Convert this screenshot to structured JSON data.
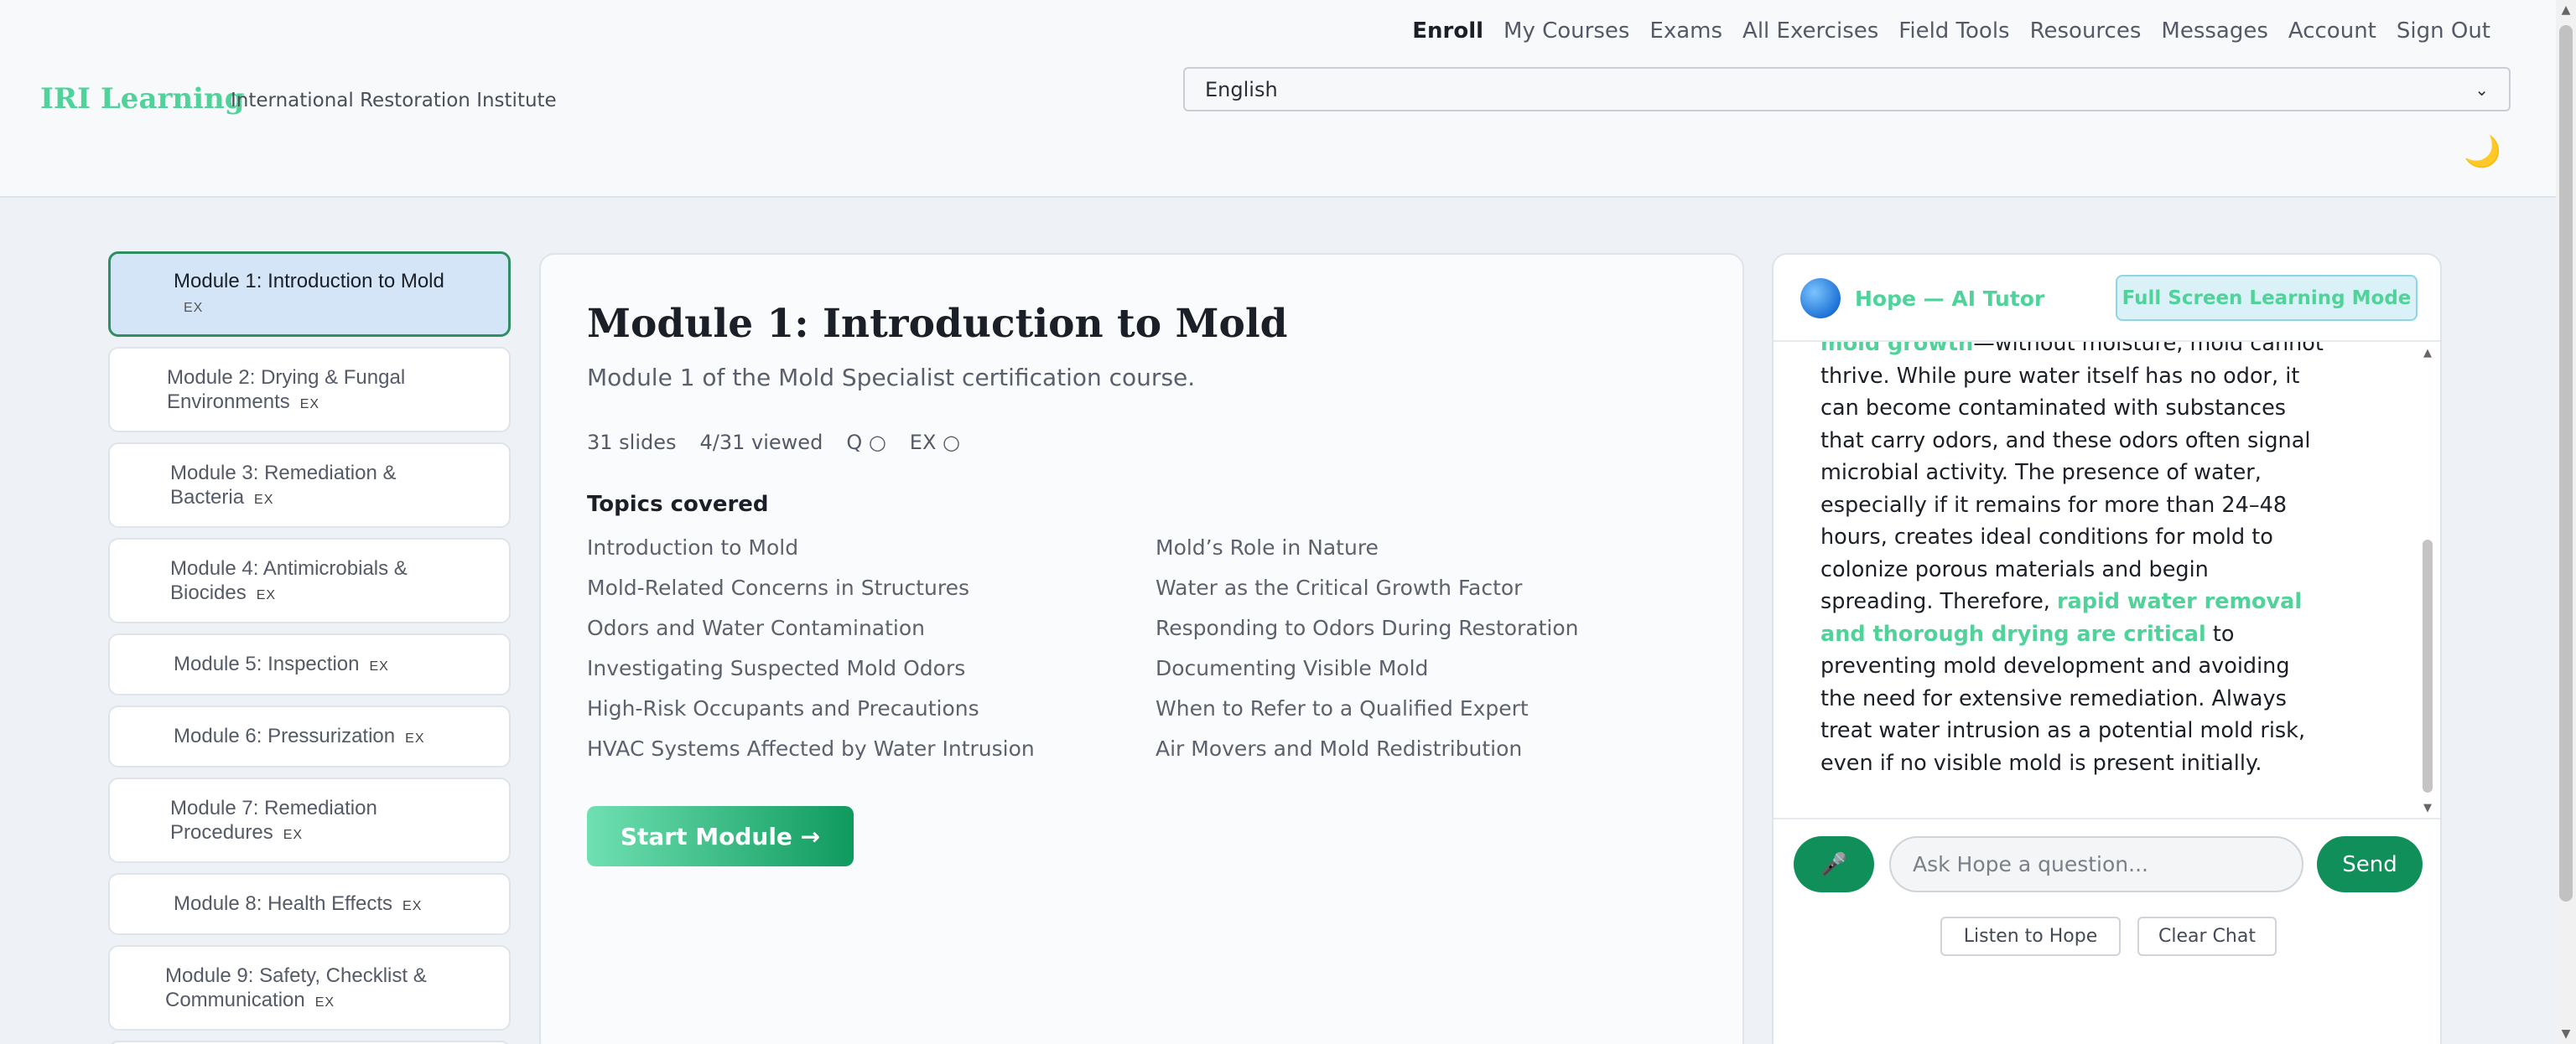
{
  "brand": {
    "name": "IRI Learning",
    "subtitle": "International Restoration Institute"
  },
  "nav": [
    "Enroll",
    "My Courses",
    "Exams",
    "All Exercises",
    "Field Tools",
    "Resources",
    "Messages",
    "Account",
    "Sign Out"
  ],
  "nav_active": "Enroll",
  "language": {
    "selected": "English"
  },
  "theme_toggle_icon": "moon-icon",
  "modules": [
    {
      "title": "Module 1: Introduction to Mold",
      "badge": "EX",
      "active": true
    },
    {
      "title": "Module 2: Drying & Fungal Environments",
      "badge": "EX"
    },
    {
      "title": "Module 3: Remediation & Bacteria",
      "badge": "EX"
    },
    {
      "title": "Module 4: Antimicrobials & Biocides",
      "badge": "EX"
    },
    {
      "title": "Module 5: Inspection",
      "badge": "EX"
    },
    {
      "title": "Module 6: Pressurization",
      "badge": "EX"
    },
    {
      "title": "Module 7: Remediation Procedures",
      "badge": "EX"
    },
    {
      "title": "Module 8: Health Effects",
      "badge": "EX"
    },
    {
      "title": "Module 9: Safety, Checklist & Communication",
      "badge": "EX"
    }
  ],
  "main": {
    "title": "Module 1: Introduction to Mold",
    "subtitle": "Module 1 of the Mold Specialist certification course.",
    "meta": {
      "slides": "31 slides",
      "viewed": "4/31 viewed",
      "quiz": "Q ○",
      "exercise": "EX ○"
    },
    "topics_heading": "Topics covered",
    "topics": [
      "Introduction to Mold",
      "Mold’s Role in Nature",
      "Mold-Related Concerns in Structures",
      "Water as the Critical Growth Factor",
      "Odors and Water Contamination",
      "Responding to Odors During Restoration",
      "Investigating Suspected Mold Odors",
      "Documenting Visible Mold",
      "High-Risk Occupants and Precautions",
      "When to Refer to a Qualified Expert",
      "HVAC Systems Affected by Water Intrusion",
      "Air Movers and Mold Redistribution"
    ],
    "start_button": "Start Module →"
  },
  "tutor": {
    "name": "Hope — AI Tutor",
    "fullscreen_button": "Full Screen Learning Mode",
    "message": {
      "hl1": "mold growth",
      "p1": "—without moisture, mold cannot thrive. While pure water itself has no odor, it can become contaminated with substances that carry odors, and these odors often signal microbial activity. The presence of water, especially if it remains for more than 24–48 hours, creates ideal conditions for mold to colonize porous materials and begin spreading. Therefore, ",
      "hl2": "rapid water removal and thorough drying are critical",
      "p2": " to preventing mold development and avoiding the need for extensive remediation. Always treat water intrusion as a potential mold risk, even if no visible mold is present initially."
    },
    "input_placeholder": "Ask Hope a question...",
    "send_button": "Send",
    "mic_icon": "microphone-icon",
    "listen_button": "Listen to Hope",
    "clear_button": "Clear Chat"
  },
  "colors": {
    "accent_green": "#4fd39a",
    "button_green": "#118f5b",
    "active_module_bg": "#d4e5f7",
    "active_module_border": "#2f8f63"
  }
}
